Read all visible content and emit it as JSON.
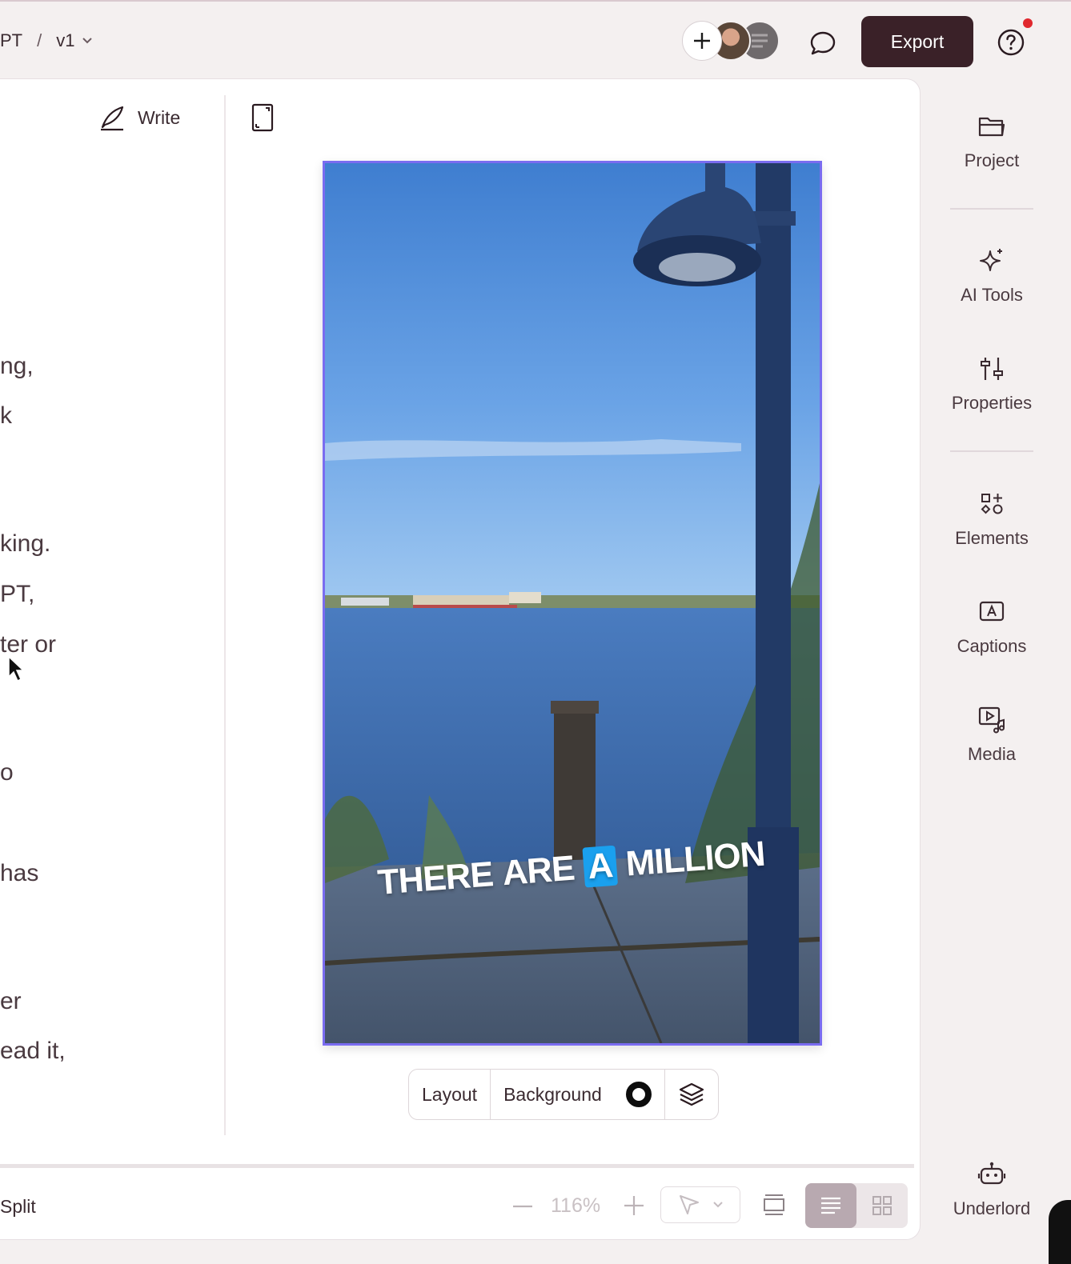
{
  "header": {
    "breadcrumb_project": "PT",
    "breadcrumb_sep": "/",
    "breadcrumb_version": "v1",
    "export_label": "Export"
  },
  "editor": {
    "write_label": "Write",
    "script_fragments": [
      "ng,",
      "k",
      "king.",
      "PT,",
      "ter or",
      "o",
      "has",
      "er",
      "ead it,"
    ]
  },
  "canvas": {
    "caption_words": [
      "THERE",
      "ARE",
      "A",
      "MILLION"
    ],
    "caption_highlight_color": "#1aa0ee",
    "selection_color": "#7a6cf0"
  },
  "canvas_toolbar": {
    "layout_label": "Layout",
    "background_label": "Background"
  },
  "bottom_bar": {
    "split_label": "Split",
    "zoom_value": "116%"
  },
  "rail": {
    "project": "Project",
    "ai_tools": "AI Tools",
    "properties": "Properties",
    "elements": "Elements",
    "captions": "Captions",
    "media": "Media",
    "underlord": "Underlord"
  },
  "colors": {
    "export_bg": "#3a2128",
    "notification": "#e0282e",
    "app_bg": "#f4f0f0"
  }
}
